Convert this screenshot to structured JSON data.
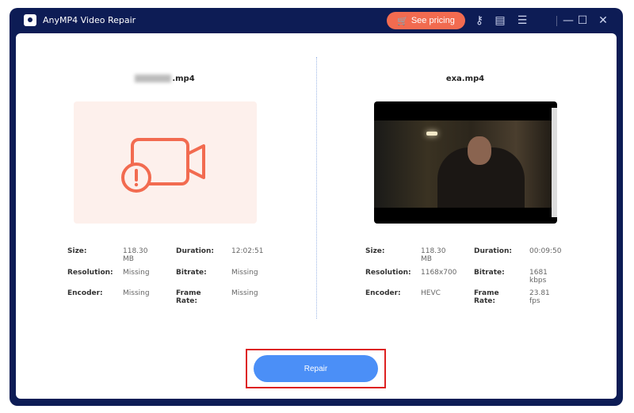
{
  "app": {
    "title": "AnyMP4 Video Repair",
    "pricing_label": "See pricing",
    "icons": [
      "key-icon",
      "feedback-icon",
      "menu-icon",
      "minimize-icon",
      "maximize-icon",
      "close-icon"
    ]
  },
  "left": {
    "filename_suffix": ".mp4",
    "fields": [
      {
        "label": "Size:",
        "value": "118.30 MB"
      },
      {
        "label": "Duration:",
        "value": "12:02:51"
      },
      {
        "label": "Resolution:",
        "value": "Missing"
      },
      {
        "label": "Bitrate:",
        "value": "Missing"
      },
      {
        "label": "Encoder:",
        "value": "Missing"
      },
      {
        "label": "Frame Rate:",
        "value": "Missing"
      }
    ]
  },
  "right": {
    "filename": "exa.mp4",
    "fields": [
      {
        "label": "Size:",
        "value": "118.30 MB"
      },
      {
        "label": "Duration:",
        "value": "00:09:50"
      },
      {
        "label": "Resolution:",
        "value": "1168x700"
      },
      {
        "label": "Bitrate:",
        "value": "1681 kbps"
      },
      {
        "label": "Encoder:",
        "value": "HEVC"
      },
      {
        "label": "Frame Rate:",
        "value": "23.81 fps"
      }
    ]
  },
  "repair_label": "Repair",
  "colors": {
    "frame": "#0d1c55",
    "accent": "#4b8ff7",
    "pricing": "#f26b50",
    "warning": "#f26b50"
  }
}
